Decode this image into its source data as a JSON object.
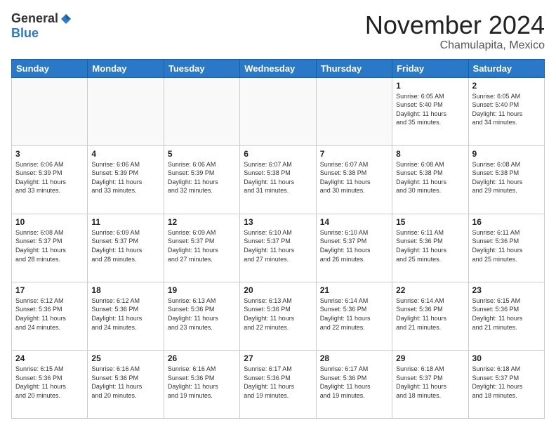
{
  "header": {
    "logo_general": "General",
    "logo_blue": "Blue",
    "month_title": "November 2024",
    "location": "Chamulapita, Mexico"
  },
  "weekdays": [
    "Sunday",
    "Monday",
    "Tuesday",
    "Wednesday",
    "Thursday",
    "Friday",
    "Saturday"
  ],
  "weeks": [
    [
      {
        "day": "",
        "info": ""
      },
      {
        "day": "",
        "info": ""
      },
      {
        "day": "",
        "info": ""
      },
      {
        "day": "",
        "info": ""
      },
      {
        "day": "",
        "info": ""
      },
      {
        "day": "1",
        "info": "Sunrise: 6:05 AM\nSunset: 5:40 PM\nDaylight: 11 hours\nand 35 minutes."
      },
      {
        "day": "2",
        "info": "Sunrise: 6:05 AM\nSunset: 5:40 PM\nDaylight: 11 hours\nand 34 minutes."
      }
    ],
    [
      {
        "day": "3",
        "info": "Sunrise: 6:06 AM\nSunset: 5:39 PM\nDaylight: 11 hours\nand 33 minutes."
      },
      {
        "day": "4",
        "info": "Sunrise: 6:06 AM\nSunset: 5:39 PM\nDaylight: 11 hours\nand 33 minutes."
      },
      {
        "day": "5",
        "info": "Sunrise: 6:06 AM\nSunset: 5:39 PM\nDaylight: 11 hours\nand 32 minutes."
      },
      {
        "day": "6",
        "info": "Sunrise: 6:07 AM\nSunset: 5:38 PM\nDaylight: 11 hours\nand 31 minutes."
      },
      {
        "day": "7",
        "info": "Sunrise: 6:07 AM\nSunset: 5:38 PM\nDaylight: 11 hours\nand 30 minutes."
      },
      {
        "day": "8",
        "info": "Sunrise: 6:08 AM\nSunset: 5:38 PM\nDaylight: 11 hours\nand 30 minutes."
      },
      {
        "day": "9",
        "info": "Sunrise: 6:08 AM\nSunset: 5:38 PM\nDaylight: 11 hours\nand 29 minutes."
      }
    ],
    [
      {
        "day": "10",
        "info": "Sunrise: 6:08 AM\nSunset: 5:37 PM\nDaylight: 11 hours\nand 28 minutes."
      },
      {
        "day": "11",
        "info": "Sunrise: 6:09 AM\nSunset: 5:37 PM\nDaylight: 11 hours\nand 28 minutes."
      },
      {
        "day": "12",
        "info": "Sunrise: 6:09 AM\nSunset: 5:37 PM\nDaylight: 11 hours\nand 27 minutes."
      },
      {
        "day": "13",
        "info": "Sunrise: 6:10 AM\nSunset: 5:37 PM\nDaylight: 11 hours\nand 27 minutes."
      },
      {
        "day": "14",
        "info": "Sunrise: 6:10 AM\nSunset: 5:37 PM\nDaylight: 11 hours\nand 26 minutes."
      },
      {
        "day": "15",
        "info": "Sunrise: 6:11 AM\nSunset: 5:36 PM\nDaylight: 11 hours\nand 25 minutes."
      },
      {
        "day": "16",
        "info": "Sunrise: 6:11 AM\nSunset: 5:36 PM\nDaylight: 11 hours\nand 25 minutes."
      }
    ],
    [
      {
        "day": "17",
        "info": "Sunrise: 6:12 AM\nSunset: 5:36 PM\nDaylight: 11 hours\nand 24 minutes."
      },
      {
        "day": "18",
        "info": "Sunrise: 6:12 AM\nSunset: 5:36 PM\nDaylight: 11 hours\nand 24 minutes."
      },
      {
        "day": "19",
        "info": "Sunrise: 6:13 AM\nSunset: 5:36 PM\nDaylight: 11 hours\nand 23 minutes."
      },
      {
        "day": "20",
        "info": "Sunrise: 6:13 AM\nSunset: 5:36 PM\nDaylight: 11 hours\nand 22 minutes."
      },
      {
        "day": "21",
        "info": "Sunrise: 6:14 AM\nSunset: 5:36 PM\nDaylight: 11 hours\nand 22 minutes."
      },
      {
        "day": "22",
        "info": "Sunrise: 6:14 AM\nSunset: 5:36 PM\nDaylight: 11 hours\nand 21 minutes."
      },
      {
        "day": "23",
        "info": "Sunrise: 6:15 AM\nSunset: 5:36 PM\nDaylight: 11 hours\nand 21 minutes."
      }
    ],
    [
      {
        "day": "24",
        "info": "Sunrise: 6:15 AM\nSunset: 5:36 PM\nDaylight: 11 hours\nand 20 minutes."
      },
      {
        "day": "25",
        "info": "Sunrise: 6:16 AM\nSunset: 5:36 PM\nDaylight: 11 hours\nand 20 minutes."
      },
      {
        "day": "26",
        "info": "Sunrise: 6:16 AM\nSunset: 5:36 PM\nDaylight: 11 hours\nand 19 minutes."
      },
      {
        "day": "27",
        "info": "Sunrise: 6:17 AM\nSunset: 5:36 PM\nDaylight: 11 hours\nand 19 minutes."
      },
      {
        "day": "28",
        "info": "Sunrise: 6:17 AM\nSunset: 5:36 PM\nDaylight: 11 hours\nand 19 minutes."
      },
      {
        "day": "29",
        "info": "Sunrise: 6:18 AM\nSunset: 5:37 PM\nDaylight: 11 hours\nand 18 minutes."
      },
      {
        "day": "30",
        "info": "Sunrise: 6:18 AM\nSunset: 5:37 PM\nDaylight: 11 hours\nand 18 minutes."
      }
    ]
  ]
}
